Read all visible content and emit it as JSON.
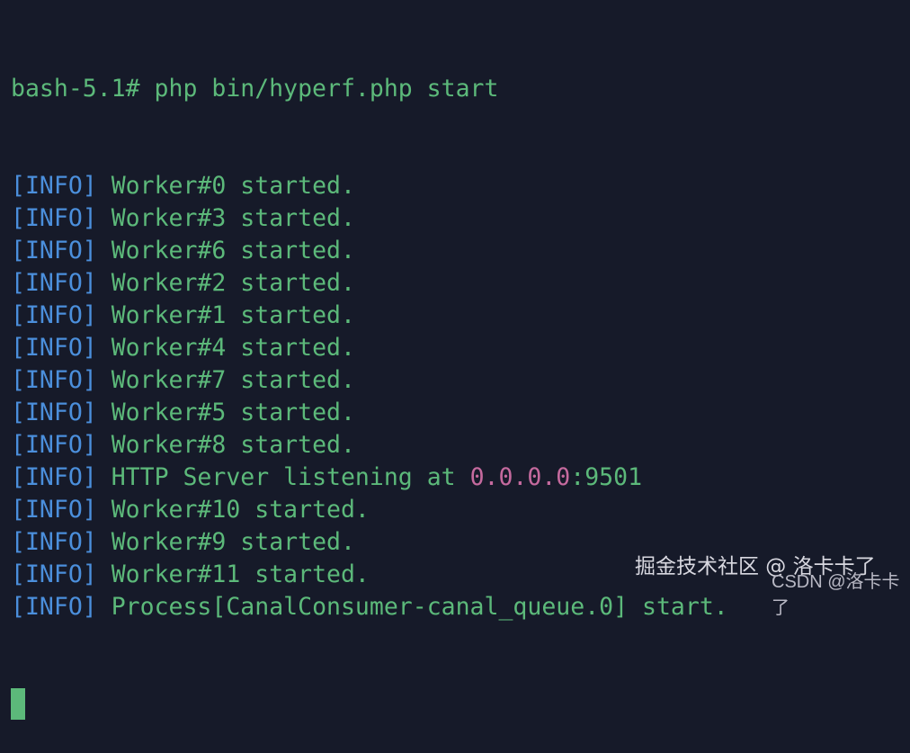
{
  "terminal": {
    "prompt_line": "bash-5.1# php bin/hyperf.php start",
    "tag": "[INFO]",
    "lines": [
      {
        "text": "Worker#0 started."
      },
      {
        "text": "Worker#3 started."
      },
      {
        "text": "Worker#6 started."
      },
      {
        "text": "Worker#2 started."
      },
      {
        "text": "Worker#1 started."
      },
      {
        "text": "Worker#4 started."
      },
      {
        "text": "Worker#7 started."
      },
      {
        "text": "Worker#5 started."
      },
      {
        "text": "Worker#8 started."
      },
      {
        "text": "HTTP Server listening at ",
        "ip": "0.0.0.0",
        "port": ":9501"
      },
      {
        "text": "Worker#10 started."
      },
      {
        "text": "Worker#9 started."
      },
      {
        "text": "Worker#11 started."
      },
      {
        "text": "Process[CanalConsumer-canal_queue.0] start."
      }
    ]
  },
  "watermarks": {
    "juejin": "掘金技术社区 @ 洛卡卡了",
    "csdn": "CSDN @洛卡卡了"
  },
  "colors": {
    "background": "#161a29",
    "text": "#5cb97a",
    "tag": "#4b8fdc",
    "address": "#c56a9e"
  }
}
